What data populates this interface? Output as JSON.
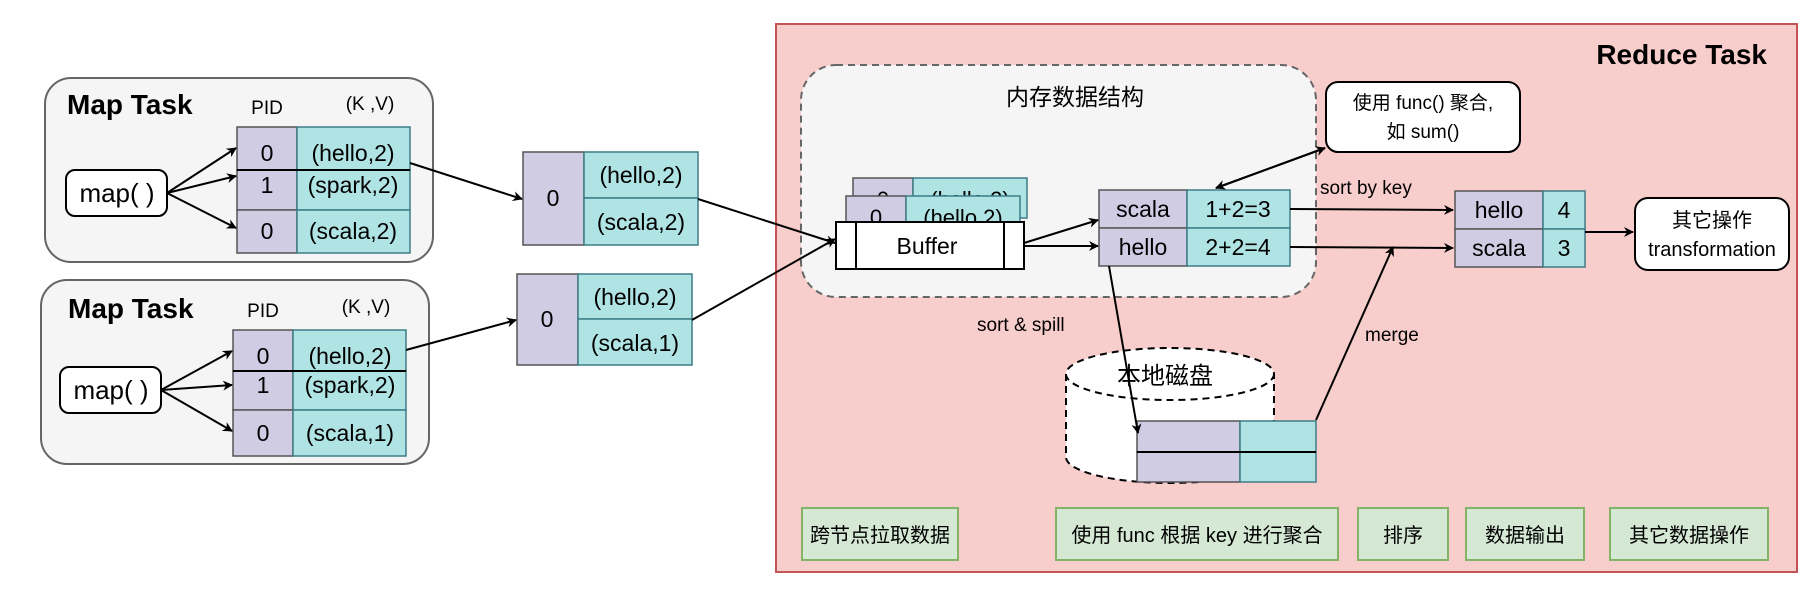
{
  "colors": {
    "purple": "#d0cce4",
    "cyan": "#b0e3e3",
    "reduce_bg": "#f8cecc",
    "reduce_border": "#c55454",
    "map_bg": "#f5f5f5",
    "label_green": "#d5e8d4",
    "label_green_border": "#82b366",
    "cell_border": "#3d7d86"
  },
  "map_tasks": [
    {
      "title": "Map Task",
      "pid_header": "PID",
      "kv_header": "(K ,V)",
      "func": "map( )",
      "rows": [
        {
          "pid": "0",
          "kv": "(hello,2)"
        },
        {
          "pid": "1",
          "kv": "(spark,2)"
        },
        {
          "pid": "0",
          "kv": "(scala,2)"
        }
      ]
    },
    {
      "title": "Map Task",
      "pid_header": "PID",
      "kv_header": "(K ,V)",
      "func": "map( )",
      "rows": [
        {
          "pid": "0",
          "kv": "(hello,2)"
        },
        {
          "pid": "1",
          "kv": "(spark,2)"
        },
        {
          "pid": "0",
          "kv": "(scala,1)"
        }
      ]
    }
  ],
  "partitions": [
    {
      "pid": "0",
      "kvs": [
        "(hello,2)",
        "(scala,2)"
      ]
    },
    {
      "pid": "0",
      "kvs": [
        "(hello,2)",
        "(scala,1)"
      ]
    }
  ],
  "reduce": {
    "title": "Reduce Task",
    "memory_title": "内存数据结构",
    "buffer_label": "Buffer",
    "buffer_ghost_pid": "0",
    "buffer_ghost_kv": "(hello,2)",
    "func_note": [
      "使用 func() 聚合,",
      "如 sum()"
    ],
    "sort_by_key": "sort by key",
    "sort_spill": "sort & spill",
    "merge": "merge",
    "disk_label": "本地磁盘",
    "aggregated": [
      {
        "key": "scala",
        "value": "1+2=3"
      },
      {
        "key": "hello",
        "value": "2+2=4"
      }
    ],
    "sorted": [
      {
        "key": "hello",
        "value": "4"
      },
      {
        "key": "scala",
        "value": "3"
      }
    ],
    "other_ops": [
      "其它操作",
      "transformation"
    ],
    "stage_labels": [
      "跨节点拉取数据",
      "使用 func 根据 key 进行聚合",
      "排序",
      "数据输出",
      "其它数据操作"
    ]
  }
}
